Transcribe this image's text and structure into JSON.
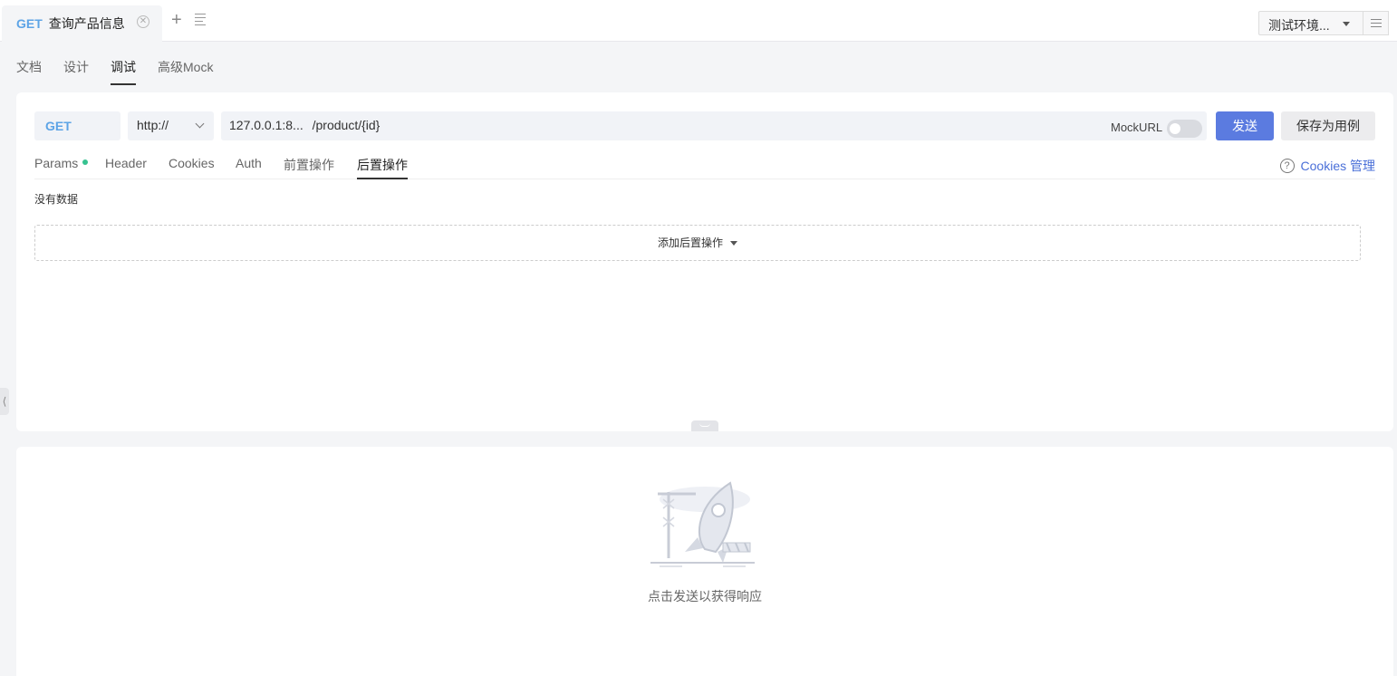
{
  "topbar": {
    "tab": {
      "method": "GET",
      "name": "查询产品信息"
    },
    "env_select": "测试环境..."
  },
  "subtabs": [
    "文档",
    "设计",
    "调试",
    "高级Mock"
  ],
  "subtab_active": "调试",
  "request": {
    "method": "GET",
    "protocol": "http://",
    "host": "127.0.0.1:8...",
    "path": "/product/{id}",
    "mock_label": "MockURL",
    "mock_enabled": false,
    "send_label": "发送",
    "save_label": "保存为用例"
  },
  "param_tabs": {
    "params": "Params",
    "header": "Header",
    "cookies": "Cookies",
    "auth": "Auth",
    "pre": "前置操作",
    "post": "后置操作"
  },
  "param_tab_active": "后置操作",
  "cookie_manage": "Cookies 管理",
  "post_ops": {
    "empty_text": "没有数据",
    "add_label": "添加后置操作"
  },
  "response": {
    "hint": "点击发送以获得响应"
  },
  "colors": {
    "method": "#5da4e6",
    "send_button": "#5b7be0",
    "link": "#4a6fd8",
    "params_dot": "#36c290"
  }
}
